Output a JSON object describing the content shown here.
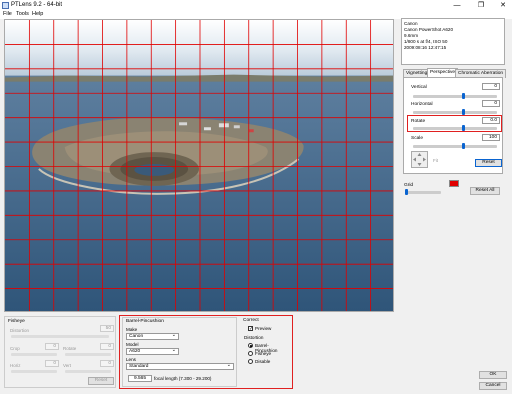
{
  "window": {
    "title": "PTLens 9.2 - 64-bit",
    "minimize": "—",
    "maximize": "❐",
    "close": "✕"
  },
  "menu": [
    "File",
    "Tools",
    "Help"
  ],
  "info": [
    "Canon",
    "Canon PowerShot A620",
    "9.6mm",
    "1/800 s at f/4, ISO 50",
    "2009:08:16 12:47:15"
  ],
  "tabs": [
    {
      "label": "Vignetting"
    },
    {
      "label": "Perspective",
      "active": true
    },
    {
      "label": "Chromatic Aberration"
    }
  ],
  "perspective": {
    "vertical": {
      "label": "Vertical",
      "value": "0",
      "level": 0.6
    },
    "horizontal": {
      "label": "Horizontal",
      "value": "0",
      "level": 0.6
    },
    "rotate": {
      "label": "Rotate",
      "value": "0.0",
      "level": 0.6
    },
    "scale": {
      "label": "Scale",
      "value": "100",
      "level": 0.6
    },
    "fit_label": "Fit",
    "reset": "Reset"
  },
  "grid": {
    "label": "Grid",
    "color": "#e00000",
    "level": 0.05
  },
  "reset_all": "Reset All",
  "fisheye": {
    "title": "Fisheye",
    "distortion": {
      "label": "Distortion",
      "value": "50"
    },
    "crop": {
      "label": "Crop",
      "value": "0"
    },
    "rotate": {
      "label": "Rotate",
      "value": "0"
    },
    "horiz": {
      "label": "Horiz",
      "value": "0"
    },
    "vert": {
      "label": "Vert",
      "value": "0"
    },
    "reset": "Reset"
  },
  "barrel": {
    "title": "Barrel-Pincushion",
    "make_label": "Make",
    "make": "Canon",
    "model_label": "Model",
    "model": "A620",
    "lens_label": "Lens",
    "lens": "Standard",
    "focal_value": "9.565",
    "focal_label": "focal length (7.300 - 29.200)"
  },
  "correct": {
    "title": "Correct",
    "preview": "Preview",
    "distortion_label": "Distortion",
    "options": [
      "Barrel-Pincushion",
      "Fisheye",
      "Disable"
    ],
    "selected": 0
  },
  "ok": "OK",
  "cancel": "Cancel"
}
